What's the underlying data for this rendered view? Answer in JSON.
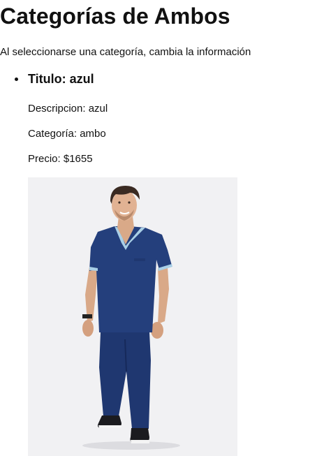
{
  "page": {
    "title": "Categorías de Ambos",
    "intro": "Al seleccionarse una categoría, cambia la información"
  },
  "products": [
    {
      "title": "Titulo: azul",
      "description": "Descripcion: azul",
      "category": "Categoría: ambo",
      "price": "Precio: $1655",
      "image": {
        "background": "#f1f1f3",
        "scrub_color": "#243f7c",
        "trim_color": "#a9cfe6"
      }
    }
  ]
}
